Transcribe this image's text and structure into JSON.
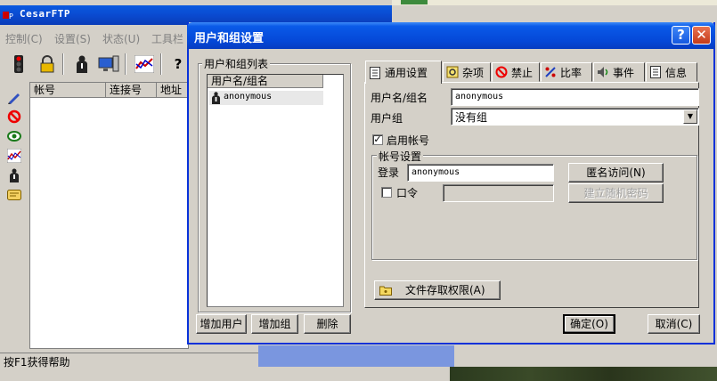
{
  "main_window": {
    "title": "CesarFTP",
    "menu": [
      "控制(C)",
      "设置(S)",
      "状态(U)",
      "工具栏"
    ],
    "toolbar_icons": [
      "traffic-light-icon",
      "lock-icon",
      "user-icon",
      "computer-icon",
      "graph-icon",
      "help-icon"
    ],
    "side_icons": [
      "pencil-icon",
      "no-entry-icon",
      "eye-icon",
      "chart-icon",
      "user-icon",
      "card-icon"
    ],
    "list_columns": [
      "帐号",
      "连接号",
      "地址"
    ],
    "status": "按F1获得帮助"
  },
  "dialog": {
    "title": "用户和组设置",
    "help_label": "?",
    "close_label": "✕",
    "users_group_label": "用户和组列表",
    "tree_header": "用户名/组名",
    "tree_items": [
      "anonymous"
    ],
    "add_user": "增加用户",
    "add_group": "增加组",
    "delete": "删除",
    "tabs": [
      "通用设置",
      "杂项",
      "禁止",
      "比率",
      "事件",
      "信息"
    ],
    "general": {
      "username_label": "用户名/组名",
      "username_value": "anonymous",
      "group_label": "用户组",
      "group_value": "没有组",
      "enable_label": "启用帐号",
      "enable_checked": "✓",
      "account_group_label": "帐号设置",
      "login_label": "登录",
      "login_value": "anonymous",
      "anon_button": "匿名访问(N)",
      "password_label": "口令",
      "password_value": "",
      "random_pw_button": "建立随机密码",
      "file_access_button": "文件存取权限(A)"
    },
    "ok": "确定(O)",
    "cancel": "取消(C)"
  },
  "colors": {
    "title_blue": "#0a5ae0",
    "window_face": "#d4d0c8",
    "close_red": "#c43a1a"
  }
}
